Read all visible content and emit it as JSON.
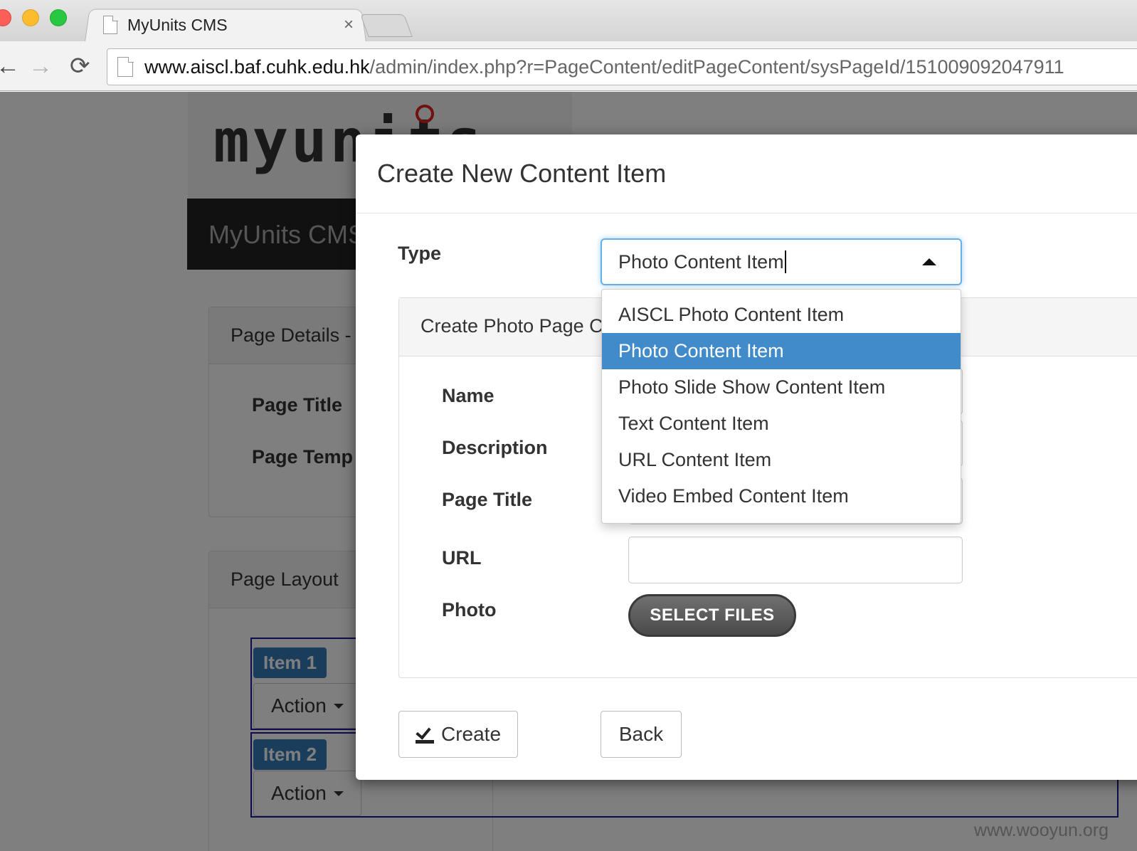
{
  "browser": {
    "tab_title": "MyUnits CMS",
    "tab_close": "×",
    "url_host": "www.aiscl.baf.cuhk.edu.hk",
    "url_path": "/admin/index.php?r=PageContent/editPageContent/sysPageId/151009092047911",
    "icons": {
      "back": "←",
      "forward": "→",
      "reload": "⟳"
    }
  },
  "background_page": {
    "logo_text": "myunits",
    "cms_title": "MyUnits CMS",
    "page_details_title": "Page Details -",
    "page_title_label": "Page Title",
    "page_template_label": "Page Temp",
    "page_layout_title": "Page Layout",
    "items": [
      {
        "badge": "Item 1",
        "action": "Action"
      },
      {
        "badge": "Item 2",
        "action": "Action"
      }
    ]
  },
  "modal": {
    "title": "Create New Content Item",
    "type_label": "Type",
    "type_value": "Photo Content Item",
    "subpanel_title": "Create Photo Page C",
    "form_labels": {
      "name": "Name",
      "description": "Description",
      "page_title": "Page Title",
      "url": "URL",
      "photo": "Photo"
    },
    "select_files": "SELECT FILES",
    "dropdown_options": [
      "AISCL Photo Content Item",
      "Photo Content Item",
      "Photo Slide Show Content Item",
      "Text Content Item",
      "URL Content Item",
      "Video Embed Content Item"
    ],
    "selected_option": "Photo Content Item",
    "create_label": "Create",
    "back_label": "Back"
  },
  "watermark": "www.wooyun.org",
  "colors": {
    "active_option": "#428bca",
    "badge": "#337ab7",
    "focus_border": "#66afe9"
  }
}
